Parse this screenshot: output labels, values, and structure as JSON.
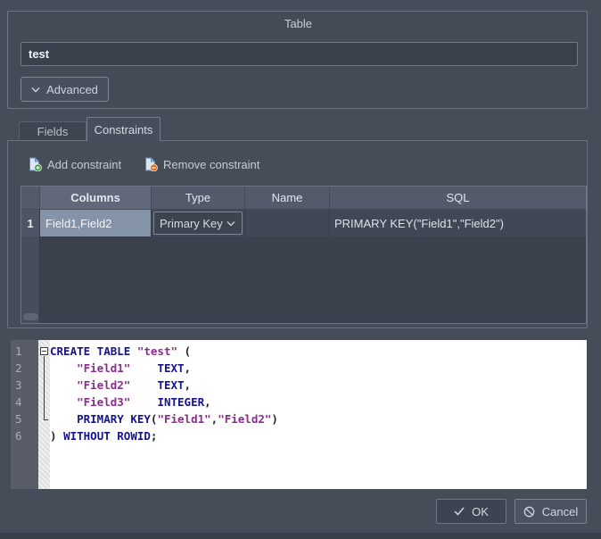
{
  "window": {
    "group_title": "Table"
  },
  "name_input": {
    "value": "test"
  },
  "advanced_button": {
    "label": "Advanced"
  },
  "tabs": {
    "fields": "Fields",
    "constraints": "Constraints"
  },
  "toolbar": {
    "add": "Add constraint",
    "remove": "Remove constraint"
  },
  "constraints_table": {
    "headers": {
      "columns": "Columns",
      "type": "Type",
      "name": "Name",
      "sql": "SQL"
    },
    "row": {
      "num": "1",
      "columns": "Field1,Field2",
      "type_selected": "Primary Key",
      "name": "",
      "sql": "PRIMARY KEY(\"Field1\",\"Field2\")"
    }
  },
  "sql_editor": {
    "lines": [
      {
        "num": "1",
        "fold": "open",
        "segments": [
          [
            "kw",
            "CREATE TABLE"
          ],
          [
            "pl",
            " "
          ],
          [
            "str",
            "\"test\""
          ],
          [
            "pl",
            " ("
          ]
        ]
      },
      {
        "num": "2",
        "fold": "line",
        "segments": [
          [
            "pl",
            "    "
          ],
          [
            "str",
            "\"Field1\""
          ],
          [
            "pl",
            "    "
          ],
          [
            "kw",
            "TEXT"
          ],
          [
            "pl",
            ","
          ]
        ]
      },
      {
        "num": "3",
        "fold": "line",
        "segments": [
          [
            "pl",
            "    "
          ],
          [
            "str",
            "\"Field2\""
          ],
          [
            "pl",
            "    "
          ],
          [
            "kw",
            "TEXT"
          ],
          [
            "pl",
            ","
          ]
        ]
      },
      {
        "num": "4",
        "fold": "line",
        "segments": [
          [
            "pl",
            "    "
          ],
          [
            "str",
            "\"Field3\""
          ],
          [
            "pl",
            "    "
          ],
          [
            "kw",
            "INTEGER"
          ],
          [
            "pl",
            ","
          ]
        ]
      },
      {
        "num": "5",
        "fold": "end",
        "segments": [
          [
            "pl",
            "    "
          ],
          [
            "kw",
            "PRIMARY KEY"
          ],
          [
            "pl",
            "("
          ],
          [
            "str",
            "\"Field1\""
          ],
          [
            "pl",
            ","
          ],
          [
            "str",
            "\"Field2\""
          ],
          [
            "pl",
            ")"
          ]
        ]
      },
      {
        "num": "6",
        "fold": "none",
        "segments": [
          [
            "pl",
            ") "
          ],
          [
            "kw",
            "WITHOUT ROWID"
          ],
          [
            "pl",
            ";"
          ]
        ]
      }
    ]
  },
  "footer": {
    "ok": "OK",
    "cancel": "Cancel"
  },
  "colors": {
    "keyword": "#14148c",
    "string": "#8b2a8f",
    "selection": "#8593a8",
    "editor_background": "#ffffff",
    "dialog_background": "#464c58"
  }
}
